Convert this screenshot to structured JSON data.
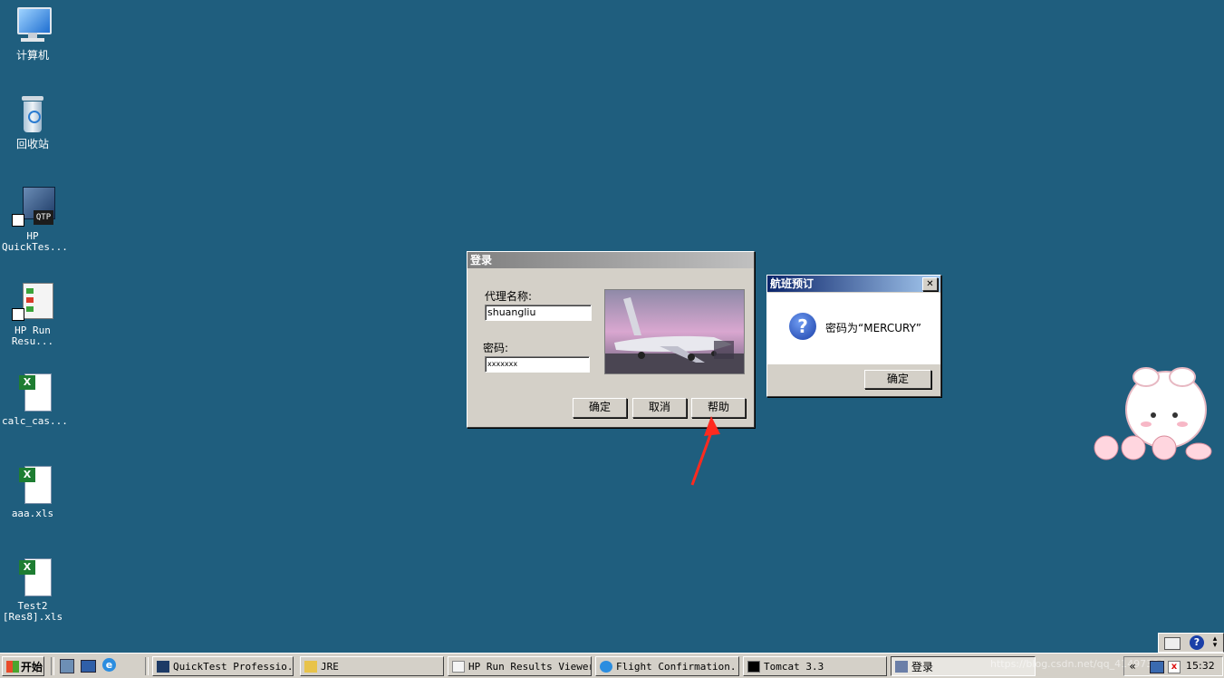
{
  "desktop": {
    "icons": [
      {
        "label": "计算机"
      },
      {
        "label": "回收站"
      },
      {
        "label": "HP QuickTes..."
      },
      {
        "label": "HP Run Resu..."
      },
      {
        "label": "calc_cas..."
      },
      {
        "label": "aaa.xls"
      },
      {
        "label": "Test2 [Res8].xls"
      }
    ]
  },
  "login_dialog": {
    "title": "登录",
    "agent_label": "代理名称:",
    "agent_value": "shuangliu",
    "password_label": "密码:",
    "password_value": "xxxxxxx",
    "ok": "确定",
    "cancel": "取消",
    "help": "帮助"
  },
  "message_box": {
    "title": "航班预订",
    "message": "密码为“MERCURY”",
    "ok": "确定",
    "close": "✕"
  },
  "taskbar": {
    "start": "开始",
    "items": [
      {
        "label": "QuickTest Professio..."
      },
      {
        "label": "JRE"
      },
      {
        "label": "HP Run Results Viewer"
      },
      {
        "label": "Flight Confirmation..."
      },
      {
        "label": "Tomcat 3.3"
      },
      {
        "label": "登录"
      }
    ],
    "tray": {
      "collapse": "«",
      "time": "15:32",
      "watermark": "https://blog.csdn.net/qq_41497336"
    }
  },
  "colors": {
    "desktop": "#1f5e7e",
    "annotation_arrow": "#ff2a1f"
  }
}
